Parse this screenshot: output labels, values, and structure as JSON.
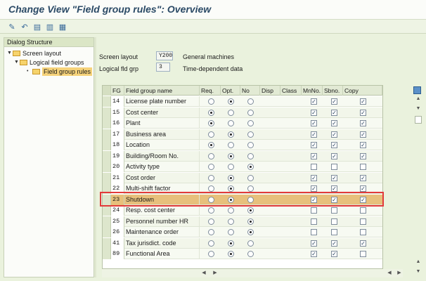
{
  "window": {
    "title": "Change View \"Field group rules\": Overview"
  },
  "toolbar": {
    "icons": [
      "wand-icon",
      "undo-icon",
      "doc-copy-icon",
      "doc-page-icon",
      "doc-export-icon"
    ]
  },
  "dialog_structure": {
    "heading": "Dialog Structure",
    "nodes": [
      {
        "label": "Screen layout",
        "level": 0
      },
      {
        "label": "Logical field groups",
        "level": 1
      },
      {
        "label": "Field group rules",
        "level": 2,
        "selected": true
      }
    ]
  },
  "header": {
    "screen_layout_label": "Screen layout",
    "screen_layout_value": "Y200",
    "screen_layout_desc": "General machines",
    "logical_fld_grp_label": "Logical fld grp",
    "logical_fld_grp_value": "3",
    "logical_fld_grp_desc": "Time-dependent data"
  },
  "table": {
    "columns": [
      "FG",
      "Field group name",
      "Req.",
      "Opt.",
      "No",
      "Disp",
      "Class",
      "MnNo.",
      "Sbno.",
      "Copy"
    ],
    "rows": [
      {
        "fg": "14",
        "name": "License plate number",
        "sel": "opt",
        "mn": true,
        "sb": true,
        "copy": true
      },
      {
        "fg": "15",
        "name": "Cost center",
        "sel": "req",
        "mn": true,
        "sb": true,
        "copy": true
      },
      {
        "fg": "16",
        "name": "Plant",
        "sel": "req",
        "mn": true,
        "sb": true,
        "copy": true
      },
      {
        "fg": "17",
        "name": "Business area",
        "sel": "opt",
        "mn": true,
        "sb": true,
        "copy": true
      },
      {
        "fg": "18",
        "name": "Location",
        "sel": "req",
        "mn": true,
        "sb": true,
        "copy": true
      },
      {
        "fg": "19",
        "name": "Building/Room No.",
        "sel": "opt",
        "mn": true,
        "sb": true,
        "copy": true
      },
      {
        "fg": "20",
        "name": "Activity type",
        "sel": "no",
        "mn": false,
        "sb": false,
        "copy": false
      },
      {
        "fg": "21",
        "name": "Cost order",
        "sel": "opt",
        "mn": true,
        "sb": true,
        "copy": true
      },
      {
        "fg": "22",
        "name": "Multi-shift factor",
        "sel": "opt",
        "mn": true,
        "sb": true,
        "copy": true
      },
      {
        "fg": "23",
        "name": "Shutdown",
        "sel": "opt",
        "mn": true,
        "sb": true,
        "copy": true,
        "highlight": true
      },
      {
        "fg": "24",
        "name": "Resp. cost center",
        "sel": "no",
        "mn": false,
        "sb": false,
        "copy": false
      },
      {
        "fg": "25",
        "name": "Personnel number HR",
        "sel": "no",
        "mn": false,
        "sb": false,
        "copy": false
      },
      {
        "fg": "26",
        "name": "Maintenance order",
        "sel": "no",
        "mn": false,
        "sb": false,
        "copy": false
      },
      {
        "fg": "41",
        "name": "Tax jurisdict. code",
        "sel": "opt",
        "mn": true,
        "sb": true,
        "copy": true
      },
      {
        "fg": "89",
        "name": "Functional Area",
        "sel": "opt",
        "mn": true,
        "sb": true,
        "copy": false
      }
    ]
  }
}
